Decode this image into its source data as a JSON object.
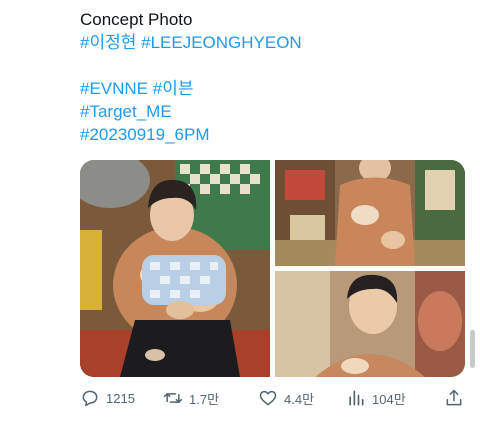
{
  "tweet": {
    "title_line": "Concept Photo",
    "tags_line1": [
      "#이정현",
      "#LEEJEONGHYEON"
    ],
    "tags_line2": [
      "#EVNNE",
      "#이븐"
    ],
    "tags_line3": "#Target_ME",
    "tags_line4": "#20230919_6PM"
  },
  "media": {
    "photos": [
      {
        "name": "concept-photo-1"
      },
      {
        "name": "concept-photo-2"
      },
      {
        "name": "concept-photo-3"
      }
    ]
  },
  "actions": {
    "reply": {
      "icon": "reply-icon",
      "count": "1215"
    },
    "retweet": {
      "icon": "retweet-icon",
      "count": "1.7만"
    },
    "like": {
      "icon": "heart-icon",
      "count": "4.4만"
    },
    "views": {
      "icon": "views-chart-icon",
      "count": "104만"
    },
    "share": {
      "icon": "share-icon"
    }
  },
  "colors": {
    "text": "#0f1419",
    "link": "#1d9bf0",
    "muted": "#536471"
  }
}
